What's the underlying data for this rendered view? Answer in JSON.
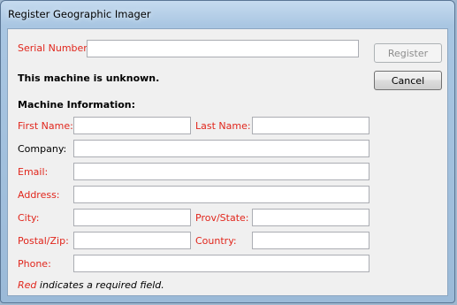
{
  "window": {
    "title": "Register Geographic Imager"
  },
  "serial": {
    "label": "Serial Number:",
    "value": ""
  },
  "buttons": {
    "register": "Register",
    "cancel": "Cancel"
  },
  "status": "This machine is unknown.",
  "section_title": "Machine Information:",
  "fields": {
    "first_name": {
      "label": "First Name:",
      "value": ""
    },
    "last_name": {
      "label": "Last Name:",
      "value": ""
    },
    "company": {
      "label": "Company:",
      "value": ""
    },
    "email": {
      "label": "Email:",
      "value": ""
    },
    "address": {
      "label": "Address:",
      "value": ""
    },
    "city": {
      "label": "City:",
      "value": ""
    },
    "prov_state": {
      "label": "Prov/State:",
      "value": ""
    },
    "postal_zip": {
      "label": "Postal/Zip:",
      "value": ""
    },
    "country": {
      "label": "Country:",
      "value": ""
    },
    "phone": {
      "label": "Phone:",
      "value": ""
    }
  },
  "footnote": {
    "red_word": "Red",
    "rest": " indicates a required field."
  },
  "colors": {
    "required": "#e1261c",
    "titlebar": "#a9c6e2",
    "dialog_bg": "#f0f0f0"
  }
}
